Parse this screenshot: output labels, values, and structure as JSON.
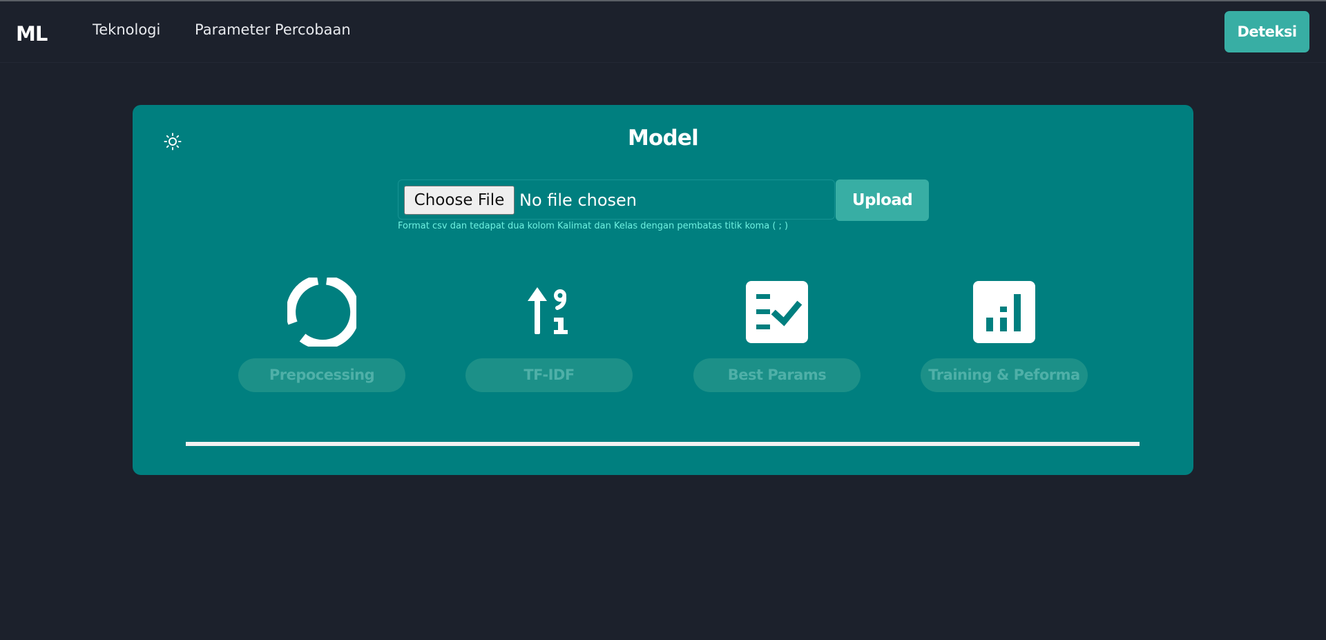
{
  "navbar": {
    "brand": "ML",
    "links": [
      "Teknologi",
      "Parameter Percobaan"
    ],
    "cta_label": "Deteksi"
  },
  "card": {
    "title": "Model",
    "theme_icon": "sun-icon",
    "file_input": {
      "button_label": "Choose File",
      "status": "No file chosen"
    },
    "upload_label": "Upload",
    "hint": "Format csv dan tedapat dua kolom Kalimat dan Kelas dengan pembatas titik koma ( ; )",
    "steps": [
      {
        "label": "Prepocessing",
        "icon": "spinner-ring-icon"
      },
      {
        "label": "TF-IDF",
        "icon": "sort-numeric-up-icon"
      },
      {
        "label": "Best Params",
        "icon": "checklist-icon"
      },
      {
        "label": "Training & Peforma",
        "icon": "bar-chart-icon"
      }
    ],
    "progress": 1.0
  },
  "colors": {
    "page_bg": "#1c212c",
    "card_bg": "#007f7f",
    "accent": "#38aea4",
    "hint_text": "#6ff0e0"
  }
}
